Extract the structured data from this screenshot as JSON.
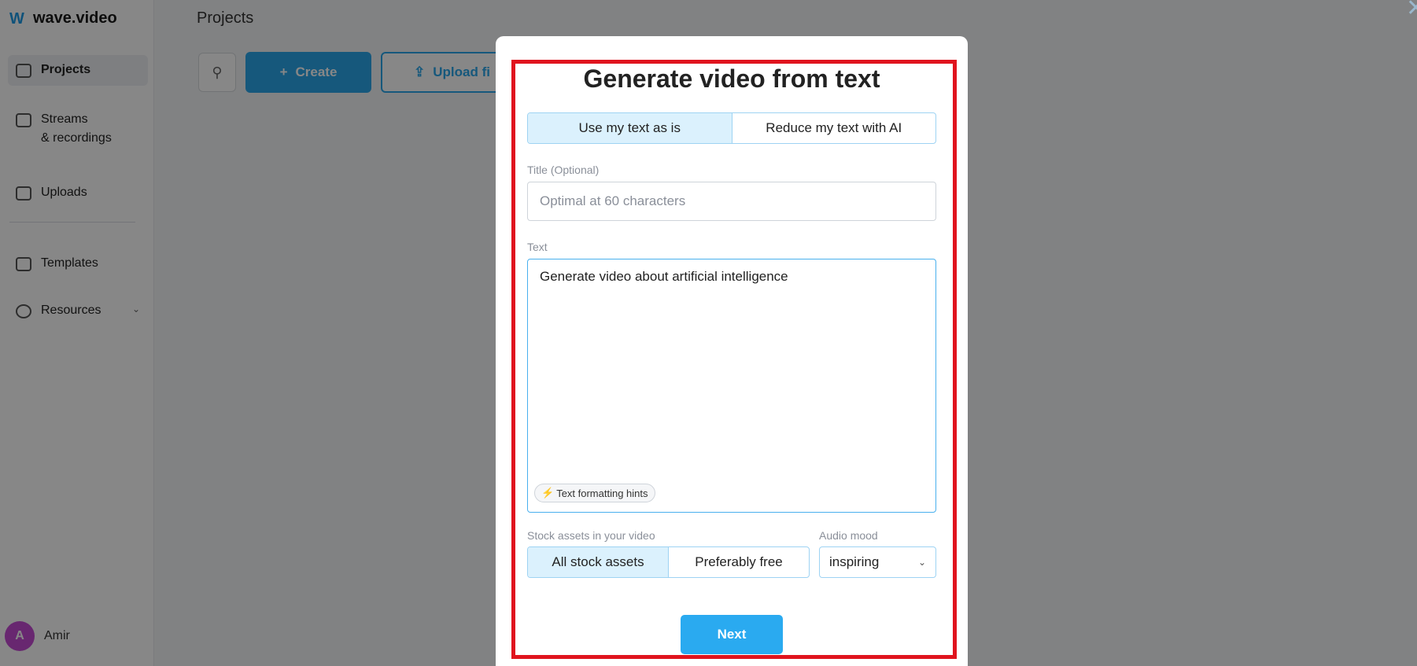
{
  "app": {
    "brand": "wave.video",
    "page_title": "Projects"
  },
  "sidebar": {
    "items": [
      {
        "label": "Projects",
        "icon": "folder-icon"
      },
      {
        "label": "Streams\n& recordings",
        "icon": "stream-icon"
      },
      {
        "label": "Uploads",
        "icon": "upload-icon"
      },
      {
        "label": "Templates",
        "icon": "template-icon"
      },
      {
        "label": "Resources",
        "icon": "resources-icon"
      }
    ],
    "user": {
      "initial": "A",
      "name": "Amir"
    }
  },
  "toolbar": {
    "create_label": "Create",
    "upload_label": "Upload fi"
  },
  "modal": {
    "title": "Generate video from text",
    "mode_options": [
      "Use my text as is",
      "Reduce my text with AI"
    ],
    "mode_selected": "Use my text as is",
    "title_field": {
      "label": "Title (Optional)",
      "placeholder": "Optimal at 60 characters",
      "value": ""
    },
    "text_field": {
      "label": "Text",
      "value": "Generate video about artificial intelligence",
      "hints_label": "Text formatting hints"
    },
    "stock": {
      "label": "Stock assets in your video",
      "options": [
        "All stock assets",
        "Preferably free"
      ],
      "selected": "All stock assets"
    },
    "audio": {
      "label": "Audio mood",
      "value": "inspiring"
    },
    "next_label": "Next"
  },
  "colors": {
    "accent": "#2aaaf0",
    "selected_bg": "#dbf1fd",
    "highlight_border": "#e0141e",
    "avatar": "#c44bd3"
  }
}
